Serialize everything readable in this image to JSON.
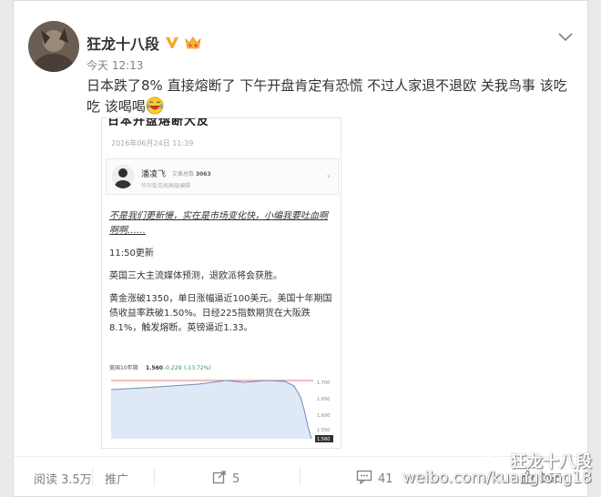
{
  "post": {
    "username": "狂龙十八段",
    "time": "今天 12:13",
    "text": "日本跌了8% 直接熔断了 下午开盘肯定有恐慌 不过人家退不退欧 关我鸟事 该吃吃 该喝喝"
  },
  "embedded": {
    "cut_header": "日本开盘熔断大反",
    "date": "2016年06月24日 11:39",
    "author_name": "潘凌飞",
    "author_meta_label": "文章总数",
    "author_count": "3063",
    "author_title": "华尔街见闻高级编辑",
    "arrow": "›",
    "italic_note": "不是我们更新慢，实在是市场变化快，小编我要吐血啊啊啊……",
    "update_time": "11:50更新",
    "p1": "英国三大主流媒体预测，退欧派将会获胜。",
    "p2": "黄金涨破1350，单日涨幅逼近100美元。美国十年期国债收益率跌破1.50%。日经225指数期货在大阪跌8.1%，触发熔断。英镑逼近1.33。",
    "chart_caption": "美国10年期",
    "chart_value": "1.560",
    "chart_change": "-0.229",
    "chart_pct": "(-13.72%)",
    "chart_axis": [
      "1.700",
      "1.650",
      "1.600",
      "1.550"
    ],
    "chart_last": "1.560"
  },
  "footer": {
    "reads": "阅读 3.5万",
    "promote": "推广",
    "reposts": "5",
    "comments": "41",
    "likes": "165"
  },
  "watermark": {
    "name": "狂龙十八段",
    "url": "weibo.com/kuanglong18"
  },
  "colors": {
    "verified": "#f5a623",
    "link": "#eb7350",
    "chart_line": "#6a8fbf",
    "chart_fill": "#dfe8f5",
    "chart_ref": "#d9534f"
  }
}
